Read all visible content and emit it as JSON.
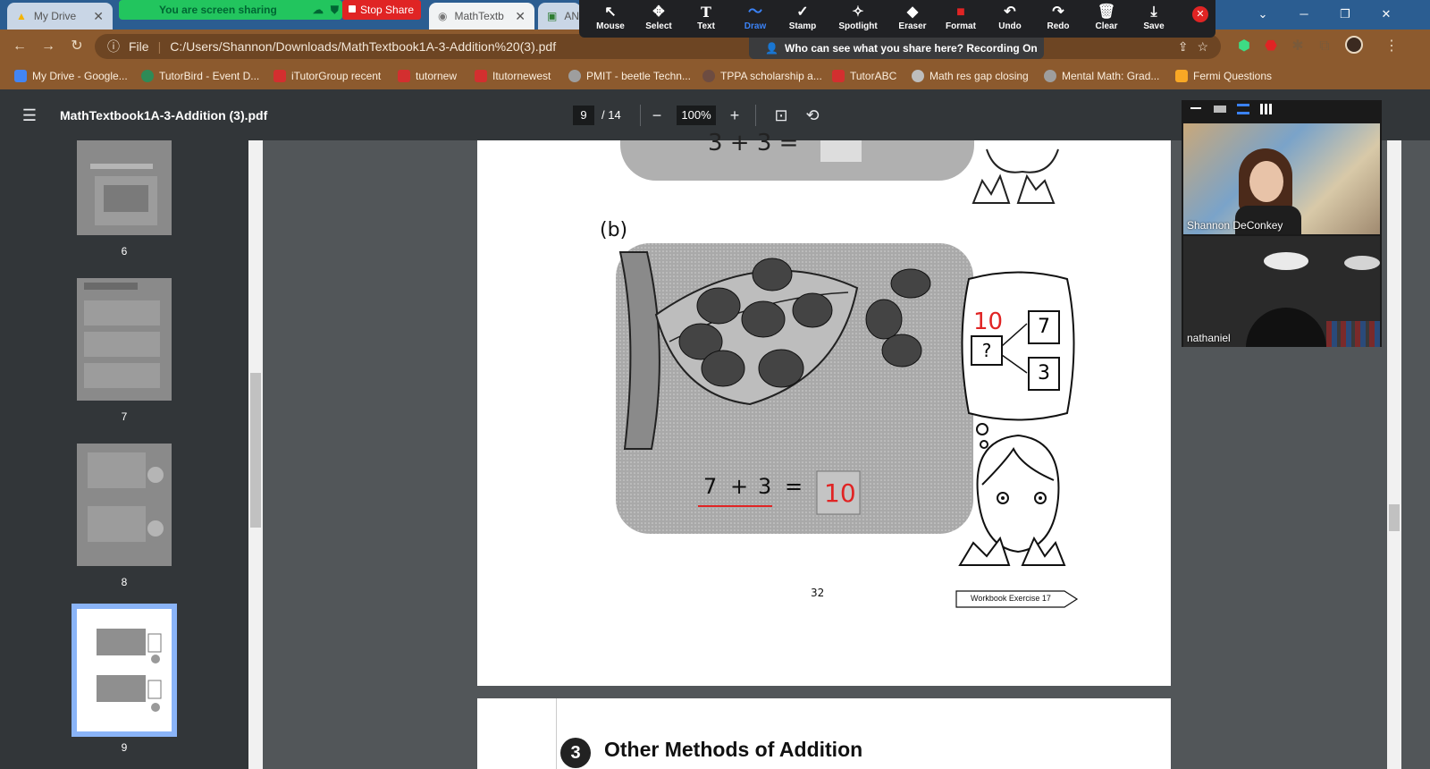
{
  "browser": {
    "tabs": [
      {
        "label": "My Drive"
      },
      {
        "label": "MathTextb"
      },
      {
        "label": "AN"
      }
    ],
    "screen_share": {
      "status": "You are screen sharing",
      "stop_label": "Stop Share"
    },
    "address": {
      "scheme_label": "File",
      "url": "C:/Users/Shannon/Downloads/MathTextbook1A-3-Addition%20(3).pdf"
    },
    "bookmarks": [
      {
        "label": "My Drive - Google...",
        "color": "#4285f4"
      },
      {
        "label": "TutorBird - Event D...",
        "color": "#2e8b57"
      },
      {
        "label": "iTutorGroup recent",
        "color": "#d32f2f"
      },
      {
        "label": "tutornew",
        "color": "#d32f2f"
      },
      {
        "label": "Itutornewest",
        "color": "#d32f2f"
      },
      {
        "label": "PMIT - beetle Techn...",
        "color": "#9e9e9e"
      },
      {
        "label": "TPPA scholarship a...",
        "color": "#6d4c41"
      },
      {
        "label": "TutorABC",
        "color": "#d32f2f"
      },
      {
        "label": "Math res gap closing",
        "color": "#bdbdbd"
      },
      {
        "label": "Mental Math: Grad...",
        "color": "#9e9e9e"
      },
      {
        "label": "Fermi Questions",
        "color": "#f9a825"
      }
    ]
  },
  "annotation_toolbar": {
    "tools": [
      {
        "label": "Mouse",
        "icon": "↖"
      },
      {
        "label": "Select",
        "icon": "✥"
      },
      {
        "label": "Text",
        "icon": "T"
      },
      {
        "label": "Draw",
        "icon": "〜"
      },
      {
        "label": "Stamp",
        "icon": "✓"
      },
      {
        "label": "Spotlight",
        "icon": "✧"
      },
      {
        "label": "Eraser",
        "icon": "◆"
      },
      {
        "label": "Format",
        "icon": "■"
      },
      {
        "label": "Undo",
        "icon": "↶"
      },
      {
        "label": "Redo",
        "icon": "↷"
      },
      {
        "label": "Clear",
        "icon": "🗑"
      },
      {
        "label": "Save",
        "icon": "⤓"
      }
    ],
    "active_tool": "Draw",
    "recording_banner": "Who can see what you share here? Recording On"
  },
  "pdf_viewer": {
    "title": "MathTextbook1A-3-Addition (3).pdf",
    "current_page": "9",
    "total_pages": "/ 14",
    "zoom": "100%",
    "thumbnails": [
      {
        "num": "6"
      },
      {
        "num": "7"
      },
      {
        "num": "8"
      },
      {
        "num": "9"
      }
    ],
    "page_content": {
      "part_label": "(b)",
      "number_bond_whole": "?",
      "number_bond_handwritten": "10",
      "number_bond_part1": "7",
      "number_bond_part2": "3",
      "equation_a": "7",
      "equation_op": "+",
      "equation_b": "3",
      "equation_eq": "=",
      "equation_answer_handwritten": "10",
      "page_number": "32",
      "workbook_ref": "Workbook Exercise 17",
      "next_heading_num": "3",
      "next_heading": "Other Methods of Addition",
      "prev_equation": "3 + 3 ="
    }
  },
  "video_panel": {
    "participants": [
      {
        "name": "Shannon DeConkey"
      },
      {
        "name": "nathaniel"
      }
    ]
  },
  "colors": {
    "annotation_red": "#e02424",
    "share_green": "#22c55e",
    "pdf_toolbar": "#323639"
  }
}
